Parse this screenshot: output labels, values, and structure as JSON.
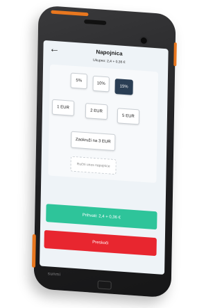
{
  "header": {
    "title": "Napojnica",
    "subtitle": "Ukupno: 2,4 + 0,36 €"
  },
  "percent_options": [
    {
      "label": "5%",
      "selected": false
    },
    {
      "label": "10%",
      "selected": false
    },
    {
      "label": "15%",
      "selected": true
    }
  ],
  "fixed_options": [
    {
      "label": "1 EUR"
    },
    {
      "label": "2 EUR"
    },
    {
      "label": "5 EUR"
    }
  ],
  "round_up_label": "Zaokruži na 3 EUR",
  "manual_entry_label": "Ručni unos napojnice",
  "accept_label": "Prihvati: 2,4 + 0,36 €",
  "skip_label": "Preskoči",
  "colors": {
    "selected": "#2a3e54",
    "accept": "#2ec49a",
    "skip": "#e8262f",
    "device_accent": "#e8771f"
  }
}
